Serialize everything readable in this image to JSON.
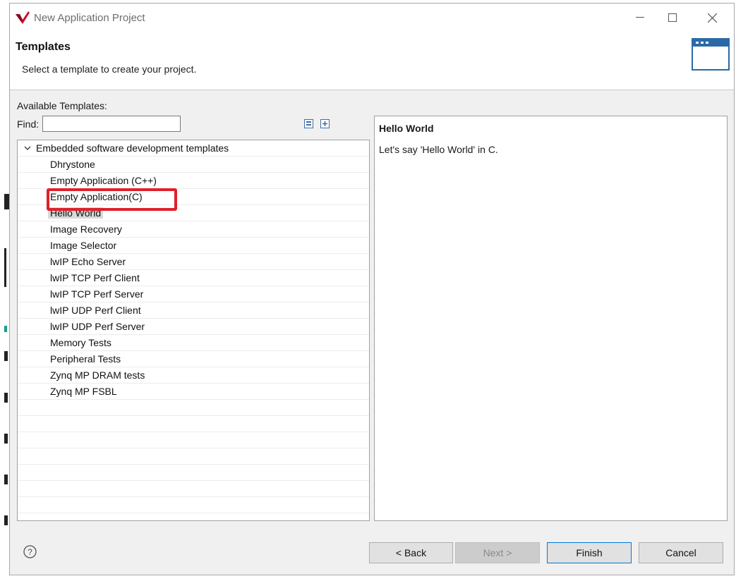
{
  "window": {
    "title": "New Application Project",
    "controls": [
      "minimize",
      "maximize",
      "close"
    ]
  },
  "header": {
    "title": "Templates",
    "description": "Select a template to create your project."
  },
  "left": {
    "available_label": "Available Templates:",
    "find_label": "Find:",
    "find_value": "",
    "tree": {
      "parent": "Embedded software development templates",
      "items": [
        "Dhrystone",
        "Empty Application (C++)",
        "Empty Application(C)",
        "Hello World",
        "Image Recovery",
        "Image Selector",
        "lwIP Echo Server",
        "lwIP TCP Perf Client",
        "lwIP TCP Perf Server",
        "lwIP UDP Perf Client",
        "lwIP UDP Perf Server",
        "Memory Tests",
        "Peripheral Tests",
        "Zynq MP DRAM tests",
        "Zynq MP FSBL"
      ],
      "selected": "Hello World",
      "highlighted": "Empty Application(C)"
    }
  },
  "description": {
    "title": "Hello World",
    "body": "Let's say 'Hello World' in C."
  },
  "buttons": {
    "back": "< Back",
    "next": "Next >",
    "finish": "Finish",
    "cancel": "Cancel"
  },
  "colors": {
    "highlight": "#e0202a",
    "brand": "#c8102e",
    "finish_border": "#0078d7"
  }
}
